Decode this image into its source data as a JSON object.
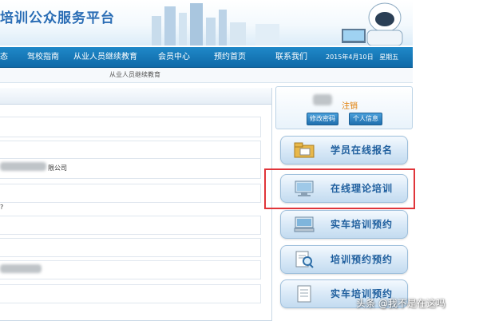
{
  "header": {
    "site_title": "培训公众服务平台"
  },
  "nav": {
    "items": [
      "态",
      "驾校指南",
      "从业人员继续教育",
      "会员中心",
      "预约首页",
      "联系我们"
    ],
    "date": "2015年4月10日",
    "weekday": "星期五"
  },
  "breadcrumb": {
    "text": "从业人员继续教育"
  },
  "main": {
    "company_suffix": "限公司",
    "stray_text": "?"
  },
  "user_panel": {
    "logout": "注销",
    "change_password": "修改密码",
    "personal_info": "个人信息"
  },
  "menu": {
    "items": [
      {
        "label": "学员在线报名",
        "icon": "folder-icon"
      },
      {
        "label": "在线理论培训",
        "icon": "monitor-icon"
      },
      {
        "label": "实车培训预约",
        "icon": "computer-icon"
      },
      {
        "label": "培训预约预约",
        "icon": "magnifier-document-icon"
      },
      {
        "label": "实车培训预约",
        "icon": "document-icon"
      }
    ]
  },
  "watermark": {
    "text": "头条 @我不是在这吗"
  },
  "colors": {
    "nav_blue": "#1378b8",
    "menu_text": "#1f5f9e",
    "highlight_red": "#e0353a",
    "logout_orange": "#e07b00"
  }
}
